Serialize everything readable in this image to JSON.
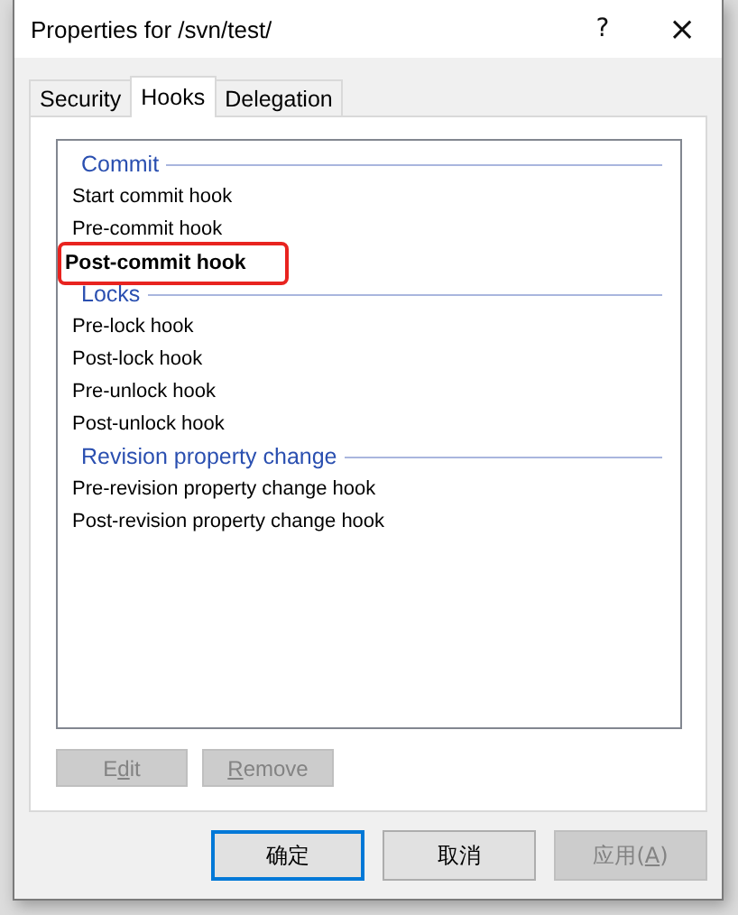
{
  "window": {
    "title": "Properties for /svn/test/",
    "help": "?",
    "close": "×"
  },
  "tabs": [
    {
      "label": "Security",
      "selected": false
    },
    {
      "label": "Hooks",
      "selected": true
    },
    {
      "label": "Delegation",
      "selected": false
    }
  ],
  "hook_groups": [
    {
      "title": "Commit",
      "items": [
        {
          "label": "Start commit hook",
          "configured": false,
          "highlighted": false
        },
        {
          "label": "Pre-commit hook",
          "configured": false,
          "highlighted": false
        },
        {
          "label": "Post-commit hook",
          "configured": true,
          "highlighted": true
        }
      ]
    },
    {
      "title": "Locks",
      "items": [
        {
          "label": "Pre-lock hook",
          "configured": false,
          "highlighted": false
        },
        {
          "label": "Post-lock hook",
          "configured": false,
          "highlighted": false
        },
        {
          "label": "Pre-unlock hook",
          "configured": false,
          "highlighted": false
        },
        {
          "label": "Post-unlock hook",
          "configured": false,
          "highlighted": false
        }
      ]
    },
    {
      "title": "Revision property change",
      "items": [
        {
          "label": "Pre-revision property change hook",
          "configured": false,
          "highlighted": false
        },
        {
          "label": "Post-revision property change hook",
          "configured": false,
          "highlighted": false
        }
      ]
    }
  ],
  "list_buttons": [
    {
      "before": "E",
      "key": "d",
      "after": "it",
      "disabled": true
    },
    {
      "key": "R",
      "after": "emove",
      "disabled": true
    }
  ],
  "dialog_buttons": [
    {
      "before": "确定",
      "disabled": false,
      "default": true
    },
    {
      "before": "取消",
      "disabled": false,
      "default": false
    },
    {
      "before": "应用(",
      "key": "A",
      "after": ")",
      "disabled": true,
      "default": false
    }
  ]
}
